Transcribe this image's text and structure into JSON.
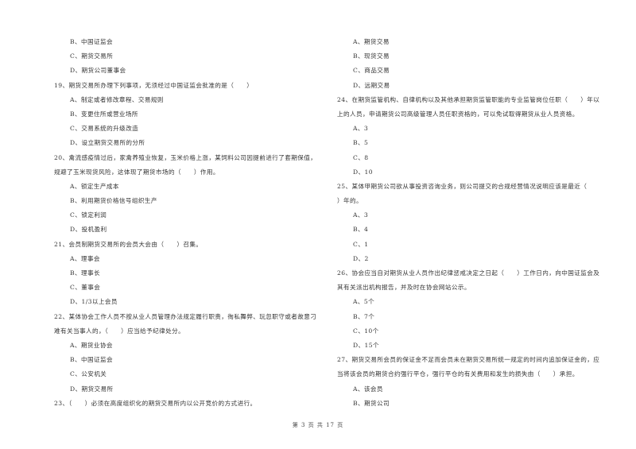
{
  "left_column": [
    {
      "type": "option",
      "text": "B、中国证监会"
    },
    {
      "type": "option",
      "text": "C、期货交易所"
    },
    {
      "type": "option",
      "text": "D、期货公司董事会"
    },
    {
      "type": "question",
      "text": "19、期货交易所办理下列事项，无须经过中国证监会批准的是（　　）"
    },
    {
      "type": "option",
      "text": "A、制定或者修改章程、交易规则"
    },
    {
      "type": "option",
      "text": "B、变更住所或营业场所"
    },
    {
      "type": "option",
      "text": "C、交易系统的升级改造"
    },
    {
      "type": "option",
      "text": "D、设立期货交易所的分所"
    },
    {
      "type": "question",
      "text": "20、禽流感疫情过后，家禽养殖业恢复，玉米价格上涨，某饲料公司因提前进行了套期保值，"
    },
    {
      "type": "question",
      "text": "规避了玉米现货风险，这体现了期货市场的（　　）作用。"
    },
    {
      "type": "option",
      "text": "A、锁定生产成本"
    },
    {
      "type": "option",
      "text": "B、利用期货价格信号组织生产"
    },
    {
      "type": "option",
      "text": "C、锁定利润"
    },
    {
      "type": "option",
      "text": "D、投机盈利"
    },
    {
      "type": "question",
      "text": "21、会员制期货交易所的会员大会由（　　）召集。"
    },
    {
      "type": "option",
      "text": "A、理事会"
    },
    {
      "type": "option",
      "text": "B、理事长"
    },
    {
      "type": "option",
      "text": "C、董事会"
    },
    {
      "type": "option",
      "text": "D、1/3以上会员"
    },
    {
      "type": "question",
      "text": "22、某体协会工作人员不按从业人员管理办法规定履行职责，徇私舞弊、玩忽职守或者故意刁"
    },
    {
      "type": "question",
      "text": "难有关当事人的，（　　）应当给予纪律处分。"
    },
    {
      "type": "option",
      "text": "A、期货业协会"
    },
    {
      "type": "option",
      "text": "B、中国证监会"
    },
    {
      "type": "option",
      "text": "C、公安机关"
    },
    {
      "type": "option",
      "text": "D、期货交易所"
    },
    {
      "type": "question",
      "text": "23、（　　）必须在高度组织化的期货交易所内以公开竞价的方式进行。"
    }
  ],
  "right_column": [
    {
      "type": "option",
      "text": "A、期货交易"
    },
    {
      "type": "option",
      "text": "B、现货交易"
    },
    {
      "type": "option",
      "text": "C、商品交易"
    },
    {
      "type": "option",
      "text": "D、远期交易"
    },
    {
      "type": "question",
      "text": "24、在期货监管机构、自律机构以及其他承担期货监管职能的专业监管岗位任职（　　）年以"
    },
    {
      "type": "question",
      "text": "上的人员，申请期货公司高级管理人员任职资格的，可以免试取得期货从业人员资格。"
    },
    {
      "type": "option",
      "text": "A、3"
    },
    {
      "type": "option",
      "text": "B、5"
    },
    {
      "type": "option",
      "text": "C、8"
    },
    {
      "type": "option",
      "text": "D、10"
    },
    {
      "type": "question",
      "text": "25、某体甲期货公司欲从事投资咨询业务，则公司提交的合规经营情况说明应该是最近（"
    },
    {
      "type": "question",
      "text": "）年的。"
    },
    {
      "type": "option",
      "text": "A、3"
    },
    {
      "type": "option",
      "text": "B、4"
    },
    {
      "type": "option",
      "text": "C、1"
    },
    {
      "type": "option",
      "text": "D、2"
    },
    {
      "type": "question",
      "text": "26、协会应当自对期货从业人员作出纪律惩戒决定之日起（　　）工作日内，向中国证监会及"
    },
    {
      "type": "question",
      "text": "其有关派出机构报告，并及时在协会网站公示。"
    },
    {
      "type": "option",
      "text": "A、5个"
    },
    {
      "type": "option",
      "text": "B、7个"
    },
    {
      "type": "option",
      "text": "C、10个"
    },
    {
      "type": "option",
      "text": "D、15个"
    },
    {
      "type": "question",
      "text": "27、期货交易所会员的保证金不足而会员未在期货交易所统一规定的时间内追加保证金的，应"
    },
    {
      "type": "question",
      "text": "当将该会员的期货合约强行平仓，强行平仓的有关费用和发生的损失由（　　）承担。"
    },
    {
      "type": "option",
      "text": "A、该会员"
    },
    {
      "type": "option",
      "text": "B、期货公司"
    }
  ],
  "footer": {
    "page_label": "第 3 页 共 17 页"
  }
}
